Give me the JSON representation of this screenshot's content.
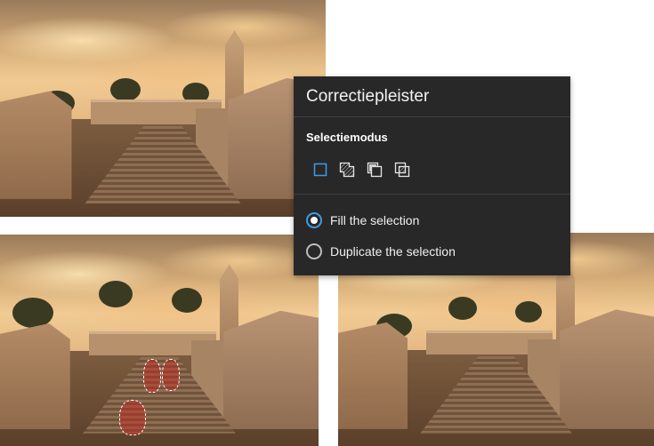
{
  "panel": {
    "title": "Correctiepleister",
    "section_label": "Selectiemodus",
    "selection_modes": [
      {
        "icon": "new-selection-icon",
        "selected": true
      },
      {
        "icon": "add-to-selection-icon",
        "selected": false
      },
      {
        "icon": "subtract-from-selection-icon",
        "selected": false
      },
      {
        "icon": "intersect-selection-icon",
        "selected": false
      }
    ],
    "options": [
      {
        "label": "Fill the selection",
        "checked": true
      },
      {
        "label": "Duplicate the selection",
        "checked": false
      }
    ],
    "accent_color": "#3c9ce6"
  }
}
